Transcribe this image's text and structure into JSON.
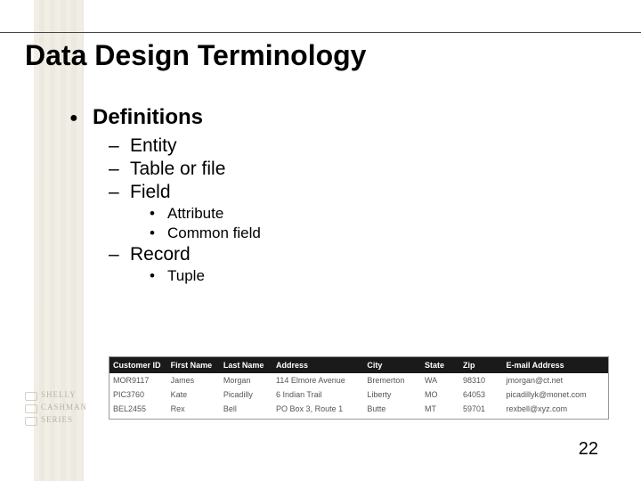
{
  "title": "Data Design Terminology",
  "bullets": {
    "l1": "Definitions",
    "l2a": "Entity",
    "l2b": "Table or file",
    "l2c": "Field",
    "l3a": "Attribute",
    "l3b": "Common field",
    "l2d": "Record",
    "l3c": "Tuple"
  },
  "table": {
    "headers": {
      "id": "Customer ID",
      "fn": "First Name",
      "ln": "Last Name",
      "addr": "Address",
      "city": "City",
      "state": "State",
      "zip": "Zip",
      "email": "E-mail Address"
    },
    "rows": [
      {
        "id": "MOR9117",
        "fn": "James",
        "ln": "Morgan",
        "addr": "114 Elmore Avenue",
        "city": "Bremerton",
        "state": "WA",
        "zip": "98310",
        "email": "jmorgan@ct.net"
      },
      {
        "id": "PIC3760",
        "fn": "Kate",
        "ln": "Picadilly",
        "addr": "6 Indian Trail",
        "city": "Liberty",
        "state": "MO",
        "zip": "64053",
        "email": "picadillyk@monet.com"
      },
      {
        "id": "BEL2455",
        "fn": "Rex",
        "ln": "Bell",
        "addr": "PO Box 3, Route 1",
        "city": "Butte",
        "state": "MT",
        "zip": "59701",
        "email": "rexbell@xyz.com"
      }
    ]
  },
  "page_number": "22",
  "logo": {
    "l1": "SHELLY",
    "l2": "CASHMAN",
    "l3": "SERIES"
  }
}
